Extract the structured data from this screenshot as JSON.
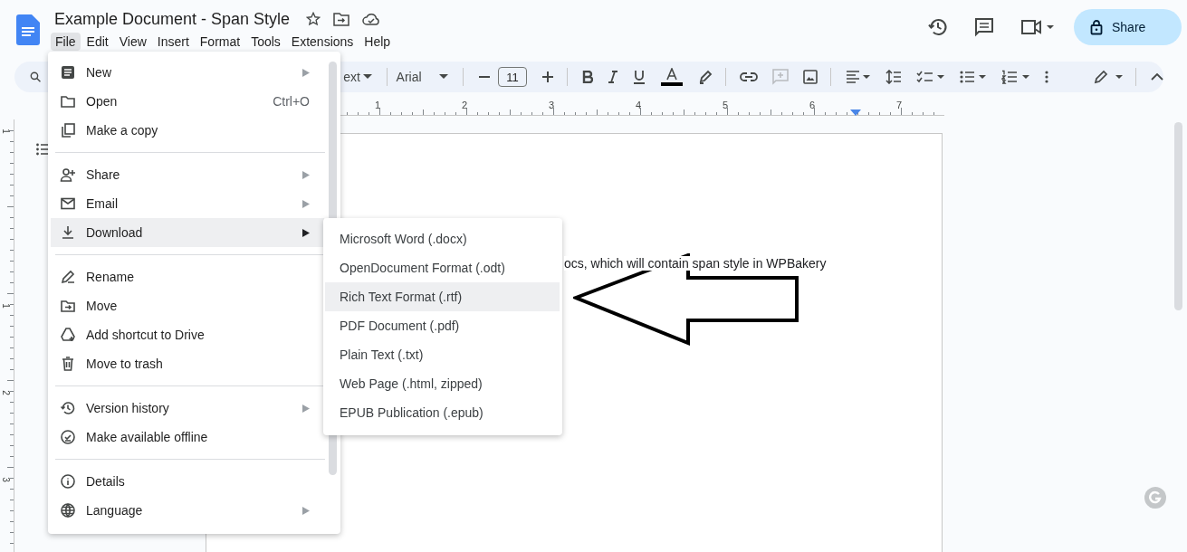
{
  "document_title": "Example Document - Span Style",
  "menubar": [
    {
      "label": "File",
      "selected": true
    },
    {
      "label": "Edit",
      "selected": false
    },
    {
      "label": "View",
      "selected": false
    },
    {
      "label": "Insert",
      "selected": false
    },
    {
      "label": "Format",
      "selected": false
    },
    {
      "label": "Tools",
      "selected": false
    },
    {
      "label": "Extensions",
      "selected": false
    },
    {
      "label": "Help",
      "selected": false
    }
  ],
  "share_button": "Share",
  "toolbar": {
    "style_dropdown": "ext",
    "font_dropdown": "Arial",
    "font_size": "11"
  },
  "ruler_numbers": [
    "1",
    "2",
    "3",
    "4",
    "5",
    "6",
    "7"
  ],
  "vertical_ruler_numbers": [
    "1",
    "1",
    "2",
    "3"
  ],
  "document_text": "ocs, which will contain span style in WPBakery",
  "file_menu": [
    [
      {
        "label": "New",
        "has_submenu": true,
        "selected": false
      },
      {
        "label": "Open",
        "shortcut": "Ctrl+O",
        "has_submenu": false,
        "selected": false
      },
      {
        "label": "Make a copy",
        "has_submenu": false,
        "selected": false
      }
    ],
    [
      {
        "label": "Share",
        "has_submenu": true,
        "selected": false
      },
      {
        "label": "Email",
        "has_submenu": true,
        "selected": false
      },
      {
        "label": "Download",
        "has_submenu": true,
        "selected": true
      }
    ],
    [
      {
        "label": "Rename",
        "has_submenu": false,
        "selected": false
      },
      {
        "label": "Move",
        "has_submenu": false,
        "selected": false
      },
      {
        "label": "Add shortcut to Drive",
        "has_submenu": false,
        "selected": false
      },
      {
        "label": "Move to trash",
        "has_submenu": false,
        "selected": false
      }
    ],
    [
      {
        "label": "Version history",
        "has_submenu": true,
        "selected": false
      },
      {
        "label": "Make available offline",
        "has_submenu": false,
        "selected": false
      }
    ],
    [
      {
        "label": "Details",
        "has_submenu": false,
        "selected": false
      },
      {
        "label": "Language",
        "has_submenu": true,
        "selected": false
      }
    ]
  ],
  "download_submenu": [
    {
      "label": "Microsoft Word (.docx)",
      "selected": false
    },
    {
      "label": "OpenDocument Format (.odt)",
      "selected": false
    },
    {
      "label": "Rich Text Format (.rtf)",
      "selected": true
    },
    {
      "label": "PDF Document (.pdf)",
      "selected": false
    },
    {
      "label": "Plain Text (.txt)",
      "selected": false
    },
    {
      "label": "Web Page (.html, zipped)",
      "selected": false
    },
    {
      "label": "EPUB Publication (.epub)",
      "selected": false
    }
  ]
}
